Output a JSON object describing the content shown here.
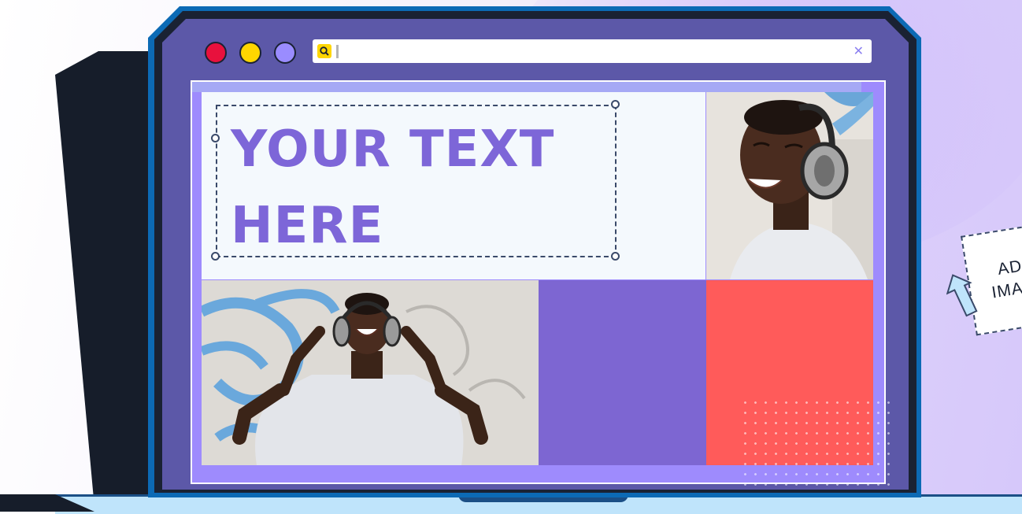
{
  "editor": {
    "headline_line1": "YOUR TEXT",
    "headline_line2": "HERE"
  },
  "address_bar": {
    "value": "",
    "clear_icon": "close-icon",
    "search_icon": "search-icon"
  },
  "window_controls": [
    {
      "name": "close",
      "color": "#e8113d"
    },
    {
      "name": "minimize",
      "color": "#ffd600"
    },
    {
      "name": "maximize",
      "color": "#9a8cff"
    }
  ],
  "add_image_card": {
    "line1": "ADD",
    "line2": "IMAGE",
    "icon": "upload-arrow-icon"
  },
  "colors": {
    "frame": "#5c58a8",
    "headline": "#7d66d8",
    "purple_block": "#7d66d2",
    "coral_block": "#ff5b5a"
  }
}
